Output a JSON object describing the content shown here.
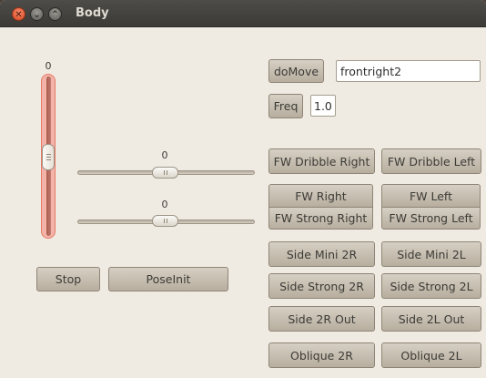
{
  "window": {
    "title": "Body",
    "close_glyph": "✕",
    "minimize_glyph": "⌄",
    "maximize_glyph": "⌃"
  },
  "sliders": {
    "vertical_value": "0",
    "horizontal_1_value": "0",
    "horizontal_2_value": "0"
  },
  "controls": {
    "stop_label": "Stop",
    "poseinit_label": "PoseInit",
    "domove_label": "doMove",
    "move_entry_value": "frontright2",
    "freq_label": "Freq",
    "freq_value": "1.0"
  },
  "motions": {
    "fw_dribble_right": "FW Dribble Right",
    "fw_dribble_left": "FW Dribble Left",
    "fw_right": "FW Right",
    "fw_left": "FW Left",
    "fw_strong_right": "FW Strong Right",
    "fw_strong_left": "FW Strong Left",
    "side_mini_2r": "Side Mini 2R",
    "side_mini_2l": "Side Mini 2L",
    "side_strong_2r": "Side Strong 2R",
    "side_strong_2l": "Side Strong 2L",
    "side_2r_out": "Side 2R Out",
    "side_2l_out": "Side 2L Out",
    "oblique_2r": "Oblique 2R",
    "oblique_2l": "Oblique 2L"
  },
  "colors": {
    "titlebar": "#3f3e3a",
    "window_bg": "#f0ebe2",
    "button": "#c9c1b4",
    "close_button": "#e0592f",
    "focused_slider": "#f4b3a8"
  }
}
